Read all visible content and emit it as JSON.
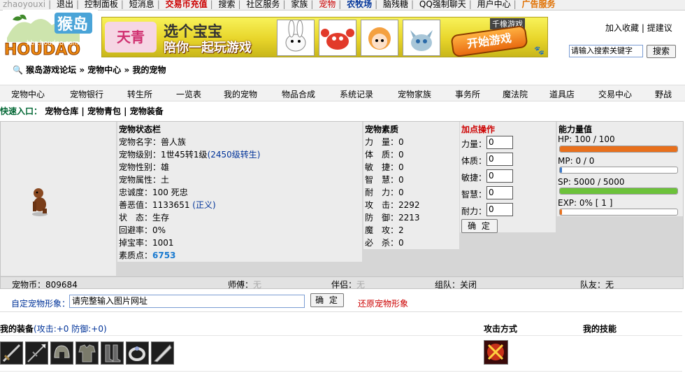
{
  "topbar": {
    "user": "zhaoyouxi",
    "items": [
      "退出",
      "控制面板",
      "短消息",
      "交易币充值",
      "搜索",
      "社区服务",
      "家族",
      "宠物",
      "农牧场",
      "脑残糖",
      "QQ强制聊天",
      "用户中心",
      "广告服务"
    ]
  },
  "logo": {
    "text": "HOUDAO",
    "site": "bbs.houdao.com"
  },
  "banner": {
    "title": "选个宝宝",
    "subtitle": "陪你一起玩游戏",
    "brand": "千橡游戏",
    "cta": "开始游戏",
    "game": "天青"
  },
  "header_links": {
    "favorite": "加入收藏",
    "suggest": "提建议"
  },
  "search": {
    "placeholder": "请输入搜索关键字",
    "button": "搜索"
  },
  "breadcrumb": {
    "home": "猴岛游戏论坛",
    "sep": "»",
    "center": "宠物中心",
    "current": "我的宠物"
  },
  "nav": [
    "宠物中心",
    "宠物银行",
    "转生所",
    "一览表",
    "我的宠物",
    "物品合成",
    "系统记录",
    "宠物家族",
    "事务所",
    "魔法院",
    "道具店",
    "交易中心",
    "野战"
  ],
  "quick": {
    "label": "快速入口：",
    "links": [
      "宠物仓库",
      "宠物青包",
      "宠物装备"
    ]
  },
  "status": {
    "title": "宠物状态栏",
    "rows": [
      {
        "label": "宠物名字：",
        "value": "兽人族"
      },
      {
        "label": "宠物级别：",
        "value": "1世45转1级",
        "extra": "(2450级转生)"
      },
      {
        "label": "宠物性别：",
        "value": "雄"
      },
      {
        "label": "宠物属性：",
        "value": "土"
      },
      {
        "label": "忠诚度：",
        "value": "100 死忠"
      },
      {
        "label": "善恶值：",
        "value": "1133651",
        "extra": "(正义)"
      },
      {
        "label": "状　态：",
        "value": "生存"
      },
      {
        "label": "回避率：",
        "value": "0%"
      },
      {
        "label": "掉宝率：",
        "value": "1001"
      },
      {
        "label": "素质点：",
        "value": "6753"
      }
    ]
  },
  "quality": {
    "title": "宠物素质",
    "rows": [
      {
        "label": "力　量：",
        "value": "0"
      },
      {
        "label": "体　质：",
        "value": "0"
      },
      {
        "label": "敏　捷：",
        "value": "0"
      },
      {
        "label": "智　慧：",
        "value": "0"
      },
      {
        "label": "耐　力：",
        "value": "0"
      },
      {
        "label": "攻　击：",
        "value": "2292"
      },
      {
        "label": "防　御：",
        "value": "2213"
      },
      {
        "label": "魔　攻：",
        "value": "2"
      },
      {
        "label": "必　杀：",
        "value": "0"
      }
    ]
  },
  "addpoint": {
    "title": "加点操作",
    "fields": [
      {
        "label": "力量：",
        "value": "0"
      },
      {
        "label": "体质：",
        "value": "0"
      },
      {
        "label": "敏捷：",
        "value": "0"
      },
      {
        "label": "智慧：",
        "value": "0"
      },
      {
        "label": "耐力：",
        "value": "0"
      }
    ],
    "confirm": "确 定"
  },
  "ability": {
    "title": "能力量值",
    "bars": [
      {
        "label": "HP:  100 / 100",
        "fraction": 1.0,
        "color": "#e8701c"
      },
      {
        "label": "MP:  0 / 0",
        "fraction": 0.0,
        "color": "#3a78c8"
      },
      {
        "label": "SP:  5000 / 5000",
        "fraction": 1.0,
        "color": "#6cc23a"
      },
      {
        "label": "EXP:  0% [ 1 ]",
        "fraction": 0.0,
        "color": "#e8701c"
      }
    ]
  },
  "info": {
    "coin_label": "宠物币：",
    "coin": "809684",
    "master_label": "师傅：",
    "master": "无",
    "partner_label": "伴侣：",
    "partner": "无",
    "team_label": "组队：",
    "team": "关闭",
    "teammate_label": "队友：",
    "teammate": "无"
  },
  "custom_image": {
    "label": "自定宠物形象：",
    "value": "请完整输入图片网址",
    "confirm": "确 定",
    "restore": "还原宠物形象"
  },
  "equipment": {
    "title": "我的装备",
    "stats": "(攻击:+0 防御:+0)",
    "attack_mode": "攻击方式",
    "skills": "我的技能",
    "items": [
      "sword",
      "lance",
      "helmet",
      "armor",
      "boots",
      "ring",
      "blade"
    ]
  }
}
